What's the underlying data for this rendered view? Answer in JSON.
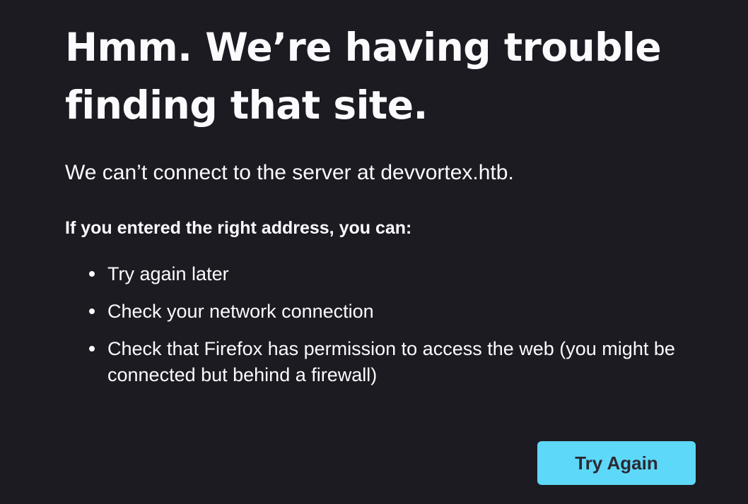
{
  "error_page": {
    "title": "Hmm. We’re having trouble finding that site.",
    "short_description": "We can’t connect to the server at devvortex.htb.",
    "sub_heading": "If you entered the right address, you can:",
    "suggestions": [
      "Try again later",
      "Check your network connection",
      "Check that Firefox has permission to access the web (you might be connected but behind a firewall)"
    ],
    "try_again_label": "Try Again"
  },
  "colors": {
    "background": "#1c1b22",
    "text": "#fbfbfe",
    "button": "#5ed8f8",
    "button_text": "#2b2a33"
  }
}
